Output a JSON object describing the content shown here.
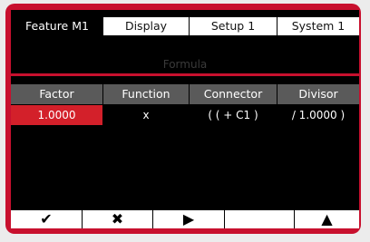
{
  "tabs": [
    {
      "label": "Feature  M1",
      "active": true
    },
    {
      "label": "Display",
      "active": false
    },
    {
      "label": "Setup 1",
      "active": false
    },
    {
      "label": "System 1",
      "active": false
    }
  ],
  "section_title": "Formula",
  "table": {
    "headers": [
      "Factor",
      "Function",
      "Connector",
      "Divisor"
    ],
    "row": [
      "1.0000",
      "x",
      "( ( + C1 )",
      "/ 1.0000 )"
    ],
    "selected_col": 0
  },
  "softkeys": [
    {
      "icon": "check-icon",
      "glyph": "✔"
    },
    {
      "icon": "cross-icon",
      "glyph": "✖"
    },
    {
      "icon": "play-icon",
      "glyph": "▶"
    },
    {
      "icon": "blank",
      "glyph": ""
    },
    {
      "icon": "up-arrow-icon",
      "glyph": "▲"
    }
  ],
  "colors": {
    "frame": "#c8102e",
    "selected": "#d3202a",
    "header": "#5a5a5a"
  }
}
